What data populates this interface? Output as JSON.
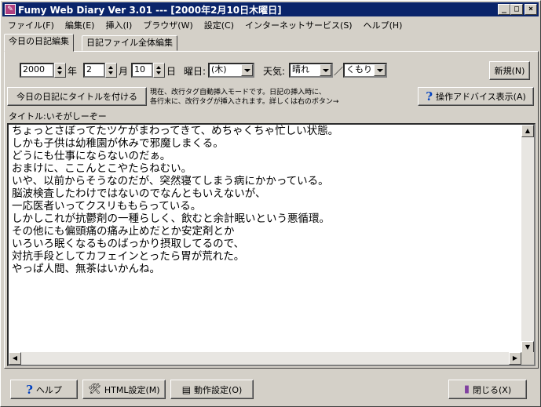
{
  "window": {
    "title": "Fumy Web Diary   Ver 3.01   --- [2000年2月10日木曜日]",
    "app_icon": "diary-icon",
    "minimize_glyph": "_",
    "maximize_glyph": "□",
    "close_glyph": "×"
  },
  "menu": [
    {
      "label": "ファイル(F)"
    },
    {
      "label": "編集(E)"
    },
    {
      "label": "挿入(I)"
    },
    {
      "label": "ブラウザ(W)"
    },
    {
      "label": "設定(C)"
    },
    {
      "label": "インターネットサービス(S)"
    },
    {
      "label": "ヘルプ(H)"
    }
  ],
  "tabs": [
    {
      "label": "今日の日記編集",
      "active": true
    },
    {
      "label": "日記ファイル全体編集",
      "active": false
    }
  ],
  "date": {
    "year": "2000",
    "year_label": "年",
    "month": "2",
    "month_label": "月",
    "day": "10",
    "day_label": "日",
    "weekday_label": "曜日:",
    "weekday": "(木)",
    "weather_label": "天気:",
    "weather1": "晴れ",
    "separator": "／",
    "weather2": "くもり"
  },
  "buttons": {
    "new": "新規(N)",
    "add_title": "今日の日記にタイトルを付ける",
    "advice": "操作アドバイス表示(A)"
  },
  "mode_note": {
    "line1": "現在、改行タグ自動挿入モードです。日記の挿入時に、",
    "line2": "各行末に、改行タグが挿入されます。詳しくは右のボタン→"
  },
  "title_line": "タイトル:いそがしーぞー",
  "diary_text": "ちょっとさぼってたツケがまわってきて、めちゃくちゃ忙しい状態。\nしかも子供は幼稚園が休みで邪魔しまくる。\nどうにも仕事にならないのだぁ。\nおまけに、ここんとこやたらねむい。\nいや、以前からそうなのだが、突然寝てしまう病にかかっている。\n脳波検査したわけではないのでなんともいえないが、\n一応医者いってクスリももらっている。\nしかしこれが抗鬱剤の一種らしく、飲むと余計眠いという悪循環。\nその他にも偏頭痛の痛み止めだとか安定剤とか\nいろいろ眠くなるものばっかり摂取してるので、\n対抗手段としてカフェインとったら胃が荒れた。\nやっぱ人間、無茶はいかんね。",
  "footer": {
    "help": "ヘルプ",
    "html_settings": "HTML設定(M)",
    "action_settings": "動作設定(O)",
    "close": "閉じる(X)"
  },
  "colors": {
    "titlebar": "#0a246a",
    "face": "#d4d0c8",
    "help_icon": "#0040c0"
  }
}
